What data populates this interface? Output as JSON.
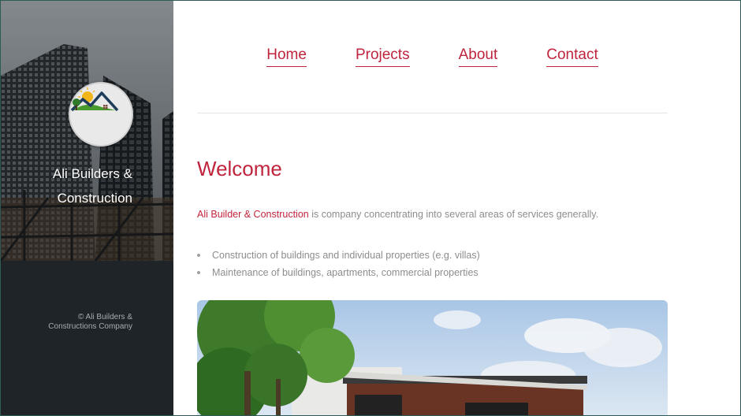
{
  "sidebar": {
    "brand_line1": "Ali Builders &",
    "brand_line2": "Construction",
    "copyright_line1": "© Ali Builders &",
    "copyright_line2": "Constructions Company"
  },
  "nav": {
    "items": [
      {
        "label": "Home"
      },
      {
        "label": "Projects"
      },
      {
        "label": "About"
      },
      {
        "label": "Contact"
      }
    ]
  },
  "main": {
    "heading": "Welcome",
    "intro_highlight": "Ali Builder & Construction",
    "intro_rest": " is company concentrating into several areas of services generally.",
    "services": [
      "Construction of buildings and individual properties (e.g. villas)",
      "Maintenance of buildings, apartments, commercial properties"
    ]
  },
  "colors": {
    "accent": "#c0243d",
    "sidebar_bg": "#1f2429",
    "body_text": "#8d8d8d"
  },
  "icons": {
    "logo": "house-roof-sun-logo-icon"
  }
}
